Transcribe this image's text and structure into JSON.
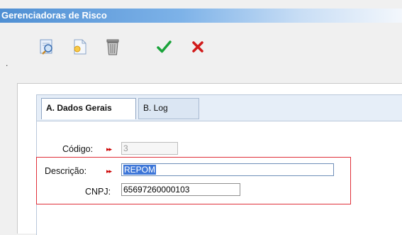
{
  "window": {
    "title": "Gerenciadoras de Risco"
  },
  "toolbar": {
    "dot": ".",
    "buttons": [
      {
        "name": "search-record",
        "icon": "search-document-icon"
      },
      {
        "name": "new-record",
        "icon": "new-document-icon"
      },
      {
        "name": "delete-record",
        "icon": "trash-icon"
      },
      {
        "name": "confirm",
        "icon": "check-icon"
      },
      {
        "name": "cancel",
        "icon": "x-icon"
      }
    ]
  },
  "tabs": [
    {
      "label": "A. Dados Gerais",
      "active": true
    },
    {
      "label": "B. Log",
      "active": false
    }
  ],
  "form": {
    "codigo": {
      "label": "Código:",
      "value": "3",
      "disabled": true
    },
    "descricao": {
      "label": "Descrição:",
      "value": "REPOM"
    },
    "cnpj": {
      "label": "CNPJ:",
      "value": "65697260000103"
    },
    "required_marker": "▸▸"
  },
  "colors": {
    "title_gradient_start": "#4f8fd3",
    "required": "#cc0000",
    "highlight_border": "#e0303a",
    "confirm": "#1aa33a",
    "cancel": "#d11a1a"
  }
}
